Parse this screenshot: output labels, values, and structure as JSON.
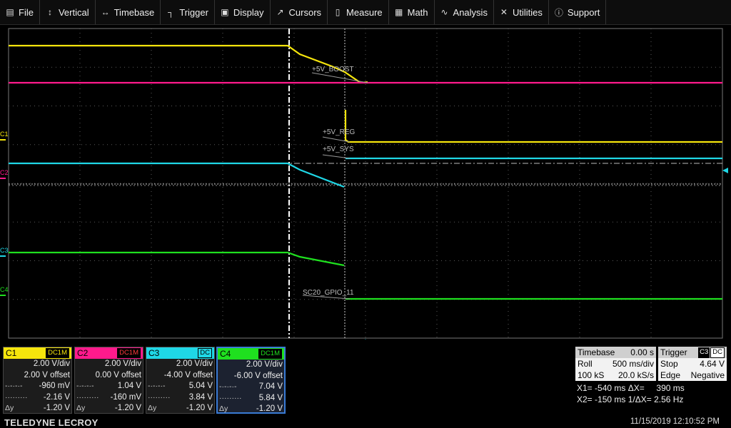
{
  "menu": [
    {
      "label": "File",
      "icon": "file-icon",
      "glyph": "▤"
    },
    {
      "label": "Vertical",
      "icon": "vertical-arrows-icon",
      "glyph": "↕"
    },
    {
      "label": "Timebase",
      "icon": "horizontal-arrows-icon",
      "glyph": "↔"
    },
    {
      "label": "Trigger",
      "icon": "trigger-icon",
      "glyph": "┐"
    },
    {
      "label": "Display",
      "icon": "display-icon",
      "glyph": "▣"
    },
    {
      "label": "Cursors",
      "icon": "cursor-icon",
      "glyph": "↗"
    },
    {
      "label": "Measure",
      "icon": "measure-icon",
      "glyph": "▯"
    },
    {
      "label": "Math",
      "icon": "math-icon",
      "glyph": "▦"
    },
    {
      "label": "Analysis",
      "icon": "analysis-icon",
      "glyph": "∿"
    },
    {
      "label": "Utilities",
      "icon": "utilities-icon",
      "glyph": "✕"
    },
    {
      "label": "Support",
      "icon": "support-icon",
      "glyph": "ⓘ"
    }
  ],
  "trace_labels": {
    "boost": "+5V_BOOST",
    "reg": "+5V_REG",
    "sys": "+5V_SYS",
    "gpio": "SC20_GPIO_11"
  },
  "channel_markers": [
    "C1",
    "C2",
    "C3",
    "C4"
  ],
  "colors": {
    "c1": "#f5e50c",
    "c2": "#ff1a8c",
    "c3": "#1fd7e6",
    "c4": "#1fe01f",
    "grid": "#5a5a5a"
  },
  "channels": [
    {
      "name": "C1",
      "coupling": "DC1M",
      "vdiv": "2.00 V/div",
      "offset": "2.00 V offset",
      "c_a_label": "-·-·-·-",
      "c_a": "-960 mV",
      "c_b_label": "·········",
      "c_b": "-2.16 V",
      "dy_label": "Δy",
      "dy": "-1.20 V"
    },
    {
      "name": "C2",
      "coupling": "DC1M",
      "vdiv": "2.00 V/div",
      "offset": "0.00 V offset",
      "c_a_label": "-·-·-·-",
      "c_a": "1.04 V",
      "c_b_label": "·········",
      "c_b": "-160 mV",
      "dy_label": "Δy",
      "dy": "-1.20 V"
    },
    {
      "name": "C3",
      "coupling": "DC",
      "vdiv": "2.00 V/div",
      "offset": "-4.00 V offset",
      "c_a_label": "-·-·-·-",
      "c_a": "5.04 V",
      "c_b_label": "·········",
      "c_b": "3.84 V",
      "dy_label": "Δy",
      "dy": "-1.20 V"
    },
    {
      "name": "C4",
      "coupling": "DC1M",
      "vdiv": "2.00 V/div",
      "offset": "-6.00 V offset",
      "c_a_label": "-·-·-·-",
      "c_a": "7.04 V",
      "c_b_label": "·········",
      "c_b": "5.84 V",
      "dy_label": "Δy",
      "dy": "-1.20 V"
    }
  ],
  "timebase": {
    "title": "Timebase",
    "delay": "0.00 s",
    "mode": "Roll",
    "scale": "500 ms/div",
    "samples": "100 kS",
    "rate": "20.0 kS/s"
  },
  "trigger": {
    "title": "Trigger",
    "source": "C3",
    "coupling": "DC",
    "mode": "Stop",
    "level": "4.64 V",
    "type": "Edge",
    "slope": "Negative"
  },
  "cursors": {
    "line1": "X1= -540 ms ΔX=     390 ms",
    "line2": "X2= -150 ms 1/ΔX= 2.56 Hz"
  },
  "brand": "TELEDYNE LECROY",
  "datetime": "11/15/2019 12:10:52 PM"
}
